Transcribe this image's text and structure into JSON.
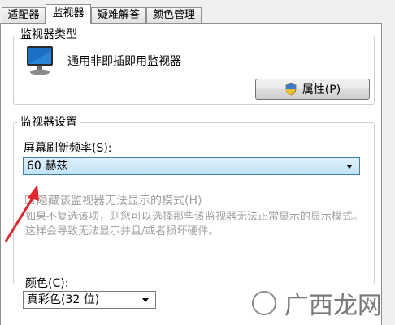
{
  "tabs": [
    "适配器",
    "监视器",
    "疑难解答",
    "颜色管理"
  ],
  "monitor_type": {
    "title": "监视器类型",
    "name": "通用非即插即用监视器",
    "properties_button": "属性(P)"
  },
  "monitor_settings": {
    "title": "监视器设置",
    "refresh_label": "屏幕刷新频率(S):",
    "refresh_value": "60 赫兹",
    "hide_modes_label": "隐藏该监视器无法显示的模式(H)",
    "hide_modes_desc": "如果不复选该项，则您可以选择那些该监视器无法正常显示的显示模式。这样会导致无法显示并且/或者损坏硬件。"
  },
  "colors": {
    "label": "颜色(C):",
    "value": "真彩色(32 位)"
  },
  "watermark": {
    "text": "广西龙网"
  },
  "theme": {
    "arrow_color": "#e0262e",
    "selection_top": "#dff0fb",
    "selection_bottom": "#c2e3f7"
  }
}
